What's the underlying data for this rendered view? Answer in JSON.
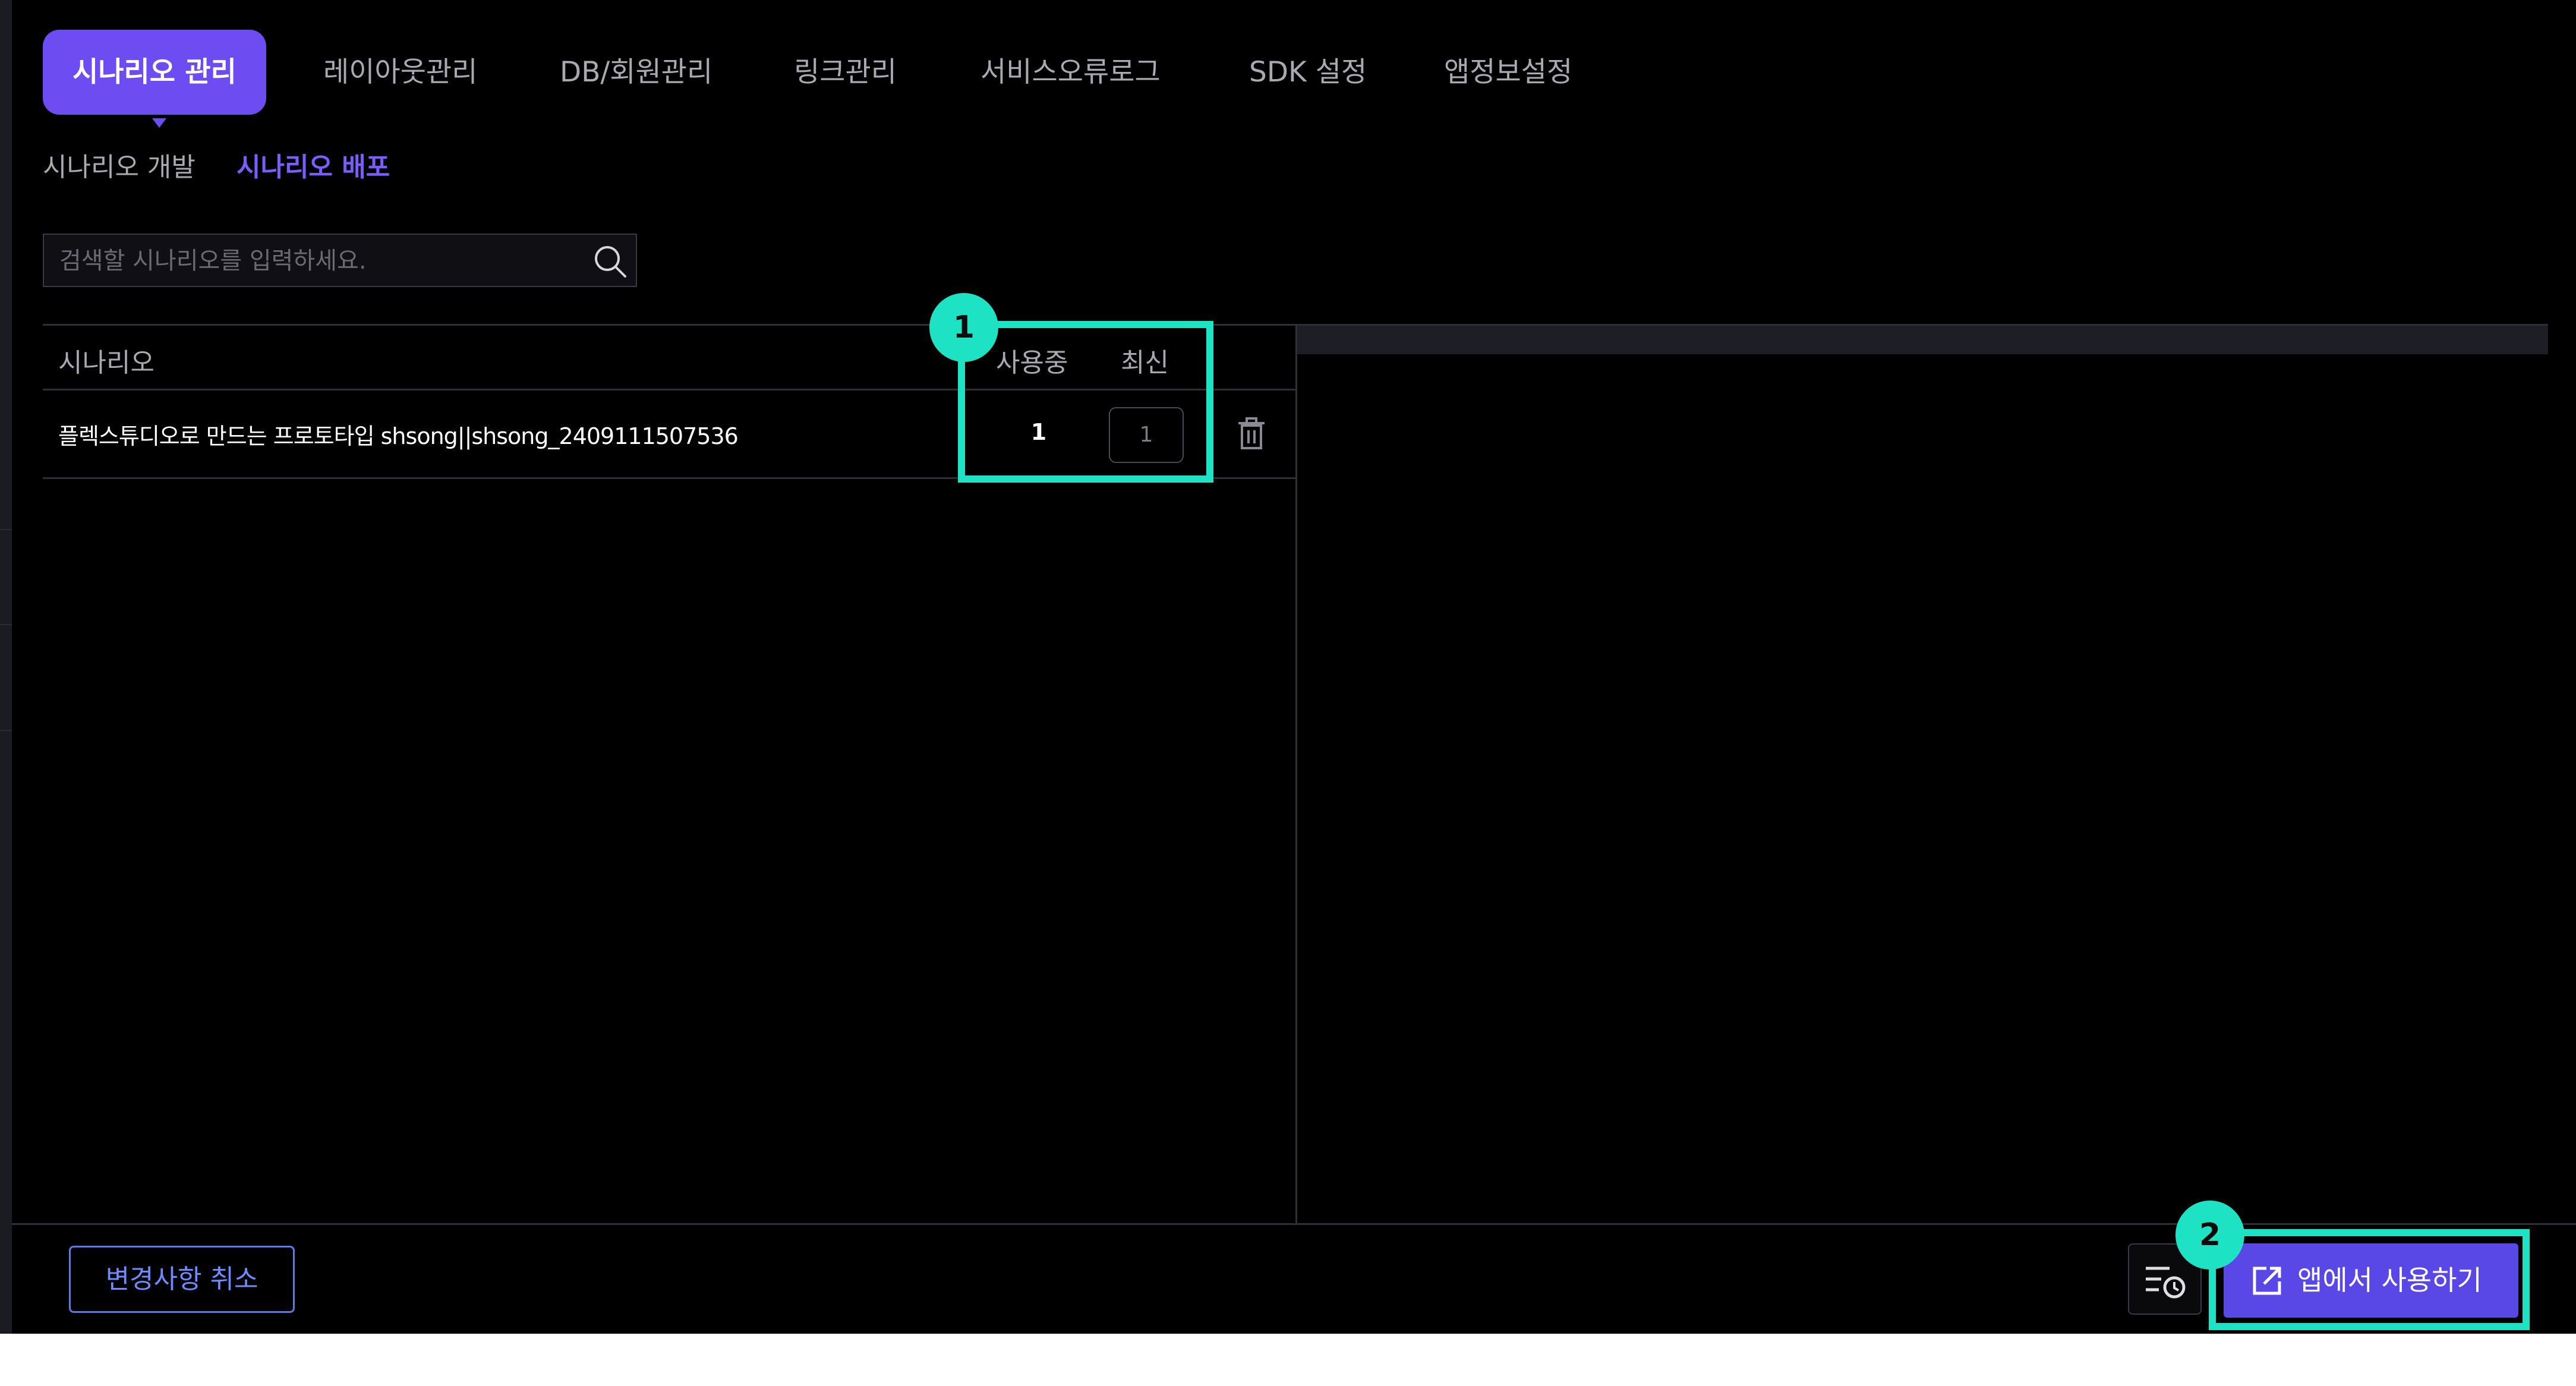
{
  "tabs": [
    {
      "label": "시나리오 관리",
      "active": true
    },
    {
      "label": "레이아웃관리",
      "active": false
    },
    {
      "label": "DB/회원관리",
      "active": false
    },
    {
      "label": "링크관리",
      "active": false
    },
    {
      "label": "서비스오류로그",
      "active": false
    },
    {
      "label": "SDK 설정",
      "active": false
    },
    {
      "label": "앱정보설정",
      "active": false
    }
  ],
  "subtabs": [
    {
      "label": "시나리오 개발",
      "active": false
    },
    {
      "label": "시나리오 배포",
      "active": true
    }
  ],
  "search": {
    "placeholder": "검색할 시나리오를 입력하세요.",
    "value": ""
  },
  "table": {
    "headers": {
      "scenario": "시나리오",
      "in_use": "사용중",
      "latest": "최신"
    },
    "rows": [
      {
        "name": "플렉스튜디오로 만드는 프로토타입 shsong||shsong_2409111507536",
        "in_use": "1",
        "latest": "1"
      }
    ]
  },
  "footer": {
    "cancel_label": "변경사항 취소",
    "use_label": "앱에서 사용하기"
  },
  "callouts": {
    "first": "1",
    "second": "2"
  },
  "colors": {
    "accent": "#6d4df2",
    "highlight": "#1ee2c4",
    "background": "#000000",
    "link_blue": "#6e8cff"
  },
  "icons": [
    "search-icon",
    "trash-icon",
    "history-icon",
    "external-link-icon"
  ]
}
